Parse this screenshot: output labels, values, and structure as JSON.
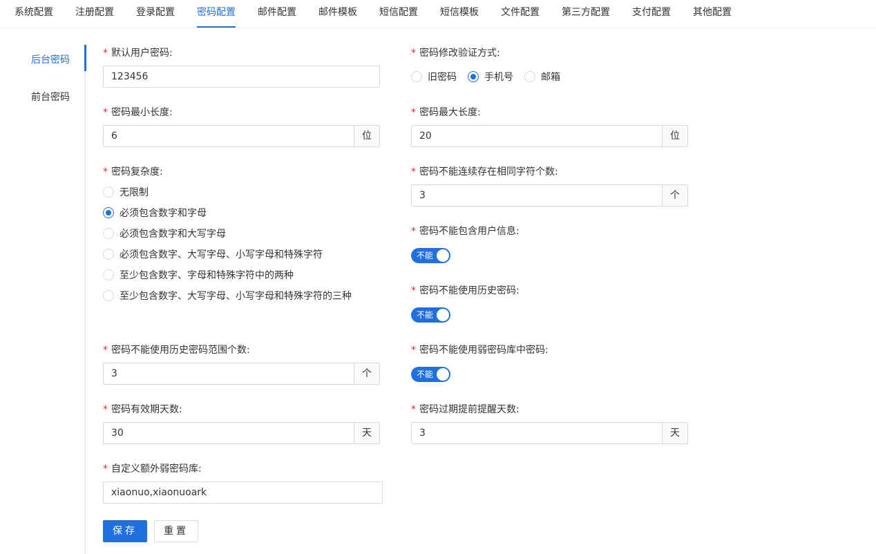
{
  "tabs": [
    "系统配置",
    "注册配置",
    "登录配置",
    "密码配置",
    "邮件配置",
    "邮件模板",
    "短信配置",
    "短信模板",
    "文件配置",
    "第三方配置",
    "支付配置",
    "其他配置"
  ],
  "active_tab": "密码配置",
  "sidebar": {
    "items": [
      {
        "label": "后台密码",
        "active": true
      },
      {
        "label": "前台密码",
        "active": false
      }
    ]
  },
  "form": {
    "required_mark": "*",
    "default_password": {
      "label": "默认用户密码:",
      "value": "123456"
    },
    "verify_method": {
      "label": "密码修改验证方式:",
      "options": [
        {
          "label": "旧密码",
          "checked": false
        },
        {
          "label": "手机号",
          "checked": true
        },
        {
          "label": "邮箱",
          "checked": false
        }
      ]
    },
    "min_length": {
      "label": "密码最小长度:",
      "value": "6",
      "unit": "位"
    },
    "max_length": {
      "label": "密码最大长度:",
      "value": "20",
      "unit": "位"
    },
    "complexity": {
      "label": "密码复杂度:",
      "options": [
        {
          "label": "无限制",
          "checked": false
        },
        {
          "label": "必须包含数字和字母",
          "checked": true
        },
        {
          "label": "必须包含数字和大写字母",
          "checked": false
        },
        {
          "label": "必须包含数字、大写字母、小写字母和特殊字符",
          "checked": false
        },
        {
          "label": "至少包含数字、字母和特殊字符中的两种",
          "checked": false
        },
        {
          "label": "至少包含数字、大写字母、小写字母和特殊字符的三种",
          "checked": false
        }
      ]
    },
    "repeat_chars": {
      "label": "密码不能连续存在相同字符个数:",
      "value": "3",
      "unit": "个"
    },
    "no_user_info": {
      "label": "密码不能包含用户信息:",
      "switch_text": "不能",
      "on": true
    },
    "no_history": {
      "label": "密码不能使用历史密码:",
      "switch_text": "不能",
      "on": true
    },
    "history_range": {
      "label": "密码不能使用历史密码范围个数:",
      "value": "3",
      "unit": "个"
    },
    "no_weak": {
      "label": "密码不能使用弱密码库中密码:",
      "switch_text": "不能",
      "on": true
    },
    "valid_days": {
      "label": "密码有效期天数:",
      "value": "30",
      "unit": "天"
    },
    "remind_days": {
      "label": "密码过期提前提醒天数:",
      "value": "3",
      "unit": "天"
    },
    "weak_library": {
      "label": "自定义额外弱密码库:",
      "value": "xiaonuo,xiaonuoark"
    }
  },
  "buttons": {
    "save": "保存",
    "reset": "重置"
  },
  "colors": {
    "primary": "#1f6fe0",
    "required": "#f5222d",
    "border": "#d9d9d9",
    "addon_bg": "#fafafa"
  }
}
